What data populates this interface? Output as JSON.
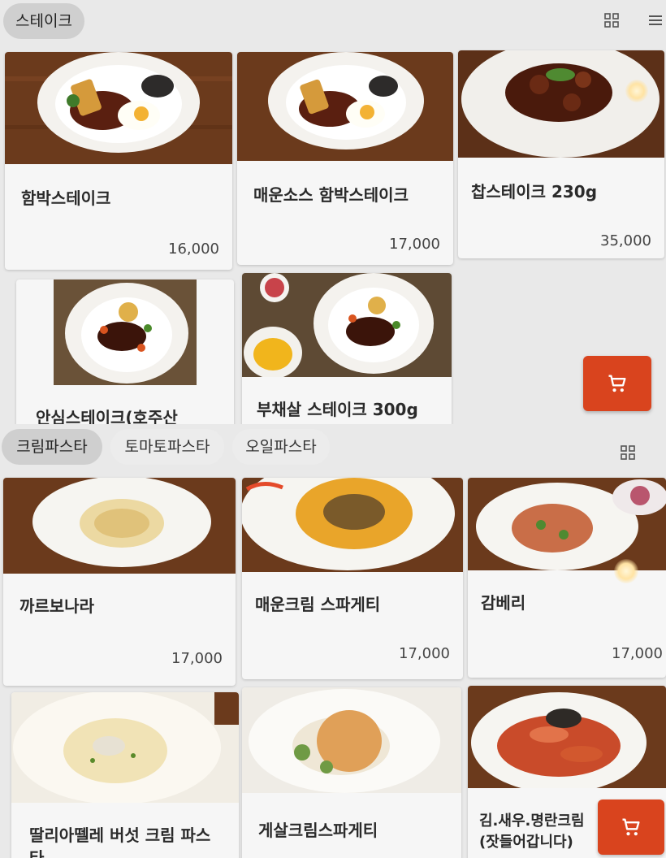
{
  "steak_section": {
    "tabs": [
      {
        "label": "스테이크",
        "active": true
      }
    ],
    "icons": [
      "grid-view-icon",
      "menu-lines-icon"
    ],
    "items": [
      {
        "name": "함박스테이크",
        "price": "16,000"
      },
      {
        "name": "매운소스 함박스테이크",
        "price": "17,000"
      },
      {
        "name": "찹스테이크 230g",
        "price": "35,000"
      },
      {
        "name": "안심스테이크(호주산",
        "price": ""
      },
      {
        "name": "부채살 스테이크 300g",
        "price": ""
      }
    ],
    "cart_icon": "cart-icon"
  },
  "pasta_section": {
    "tabs": [
      {
        "label": "크림파스타",
        "active": true
      },
      {
        "label": "토마토파스타",
        "active": false
      },
      {
        "label": "오일파스타",
        "active": false
      }
    ],
    "icons": [
      "grid-view-icon"
    ],
    "items": [
      {
        "name": "까르보나라",
        "price": "17,000"
      },
      {
        "name": "매운크림 스파게티",
        "price": "17,000"
      },
      {
        "name": "감베리",
        "price": "17,000"
      },
      {
        "name": "딸리아뗄레 버섯 크림 파스\n타",
        "price": ""
      },
      {
        "name": "게살크림스파게티",
        "price": ""
      },
      {
        "name": "김.새우.명란크림\n(잣들어갑니다)",
        "price": ""
      }
    ],
    "cart_icon": "cart-icon"
  },
  "colors": {
    "cart_button": "#d9441e",
    "active_tab": "#cfcfcf",
    "card_background": "#f6f6f6",
    "panel_background": "#e9e9e9"
  }
}
